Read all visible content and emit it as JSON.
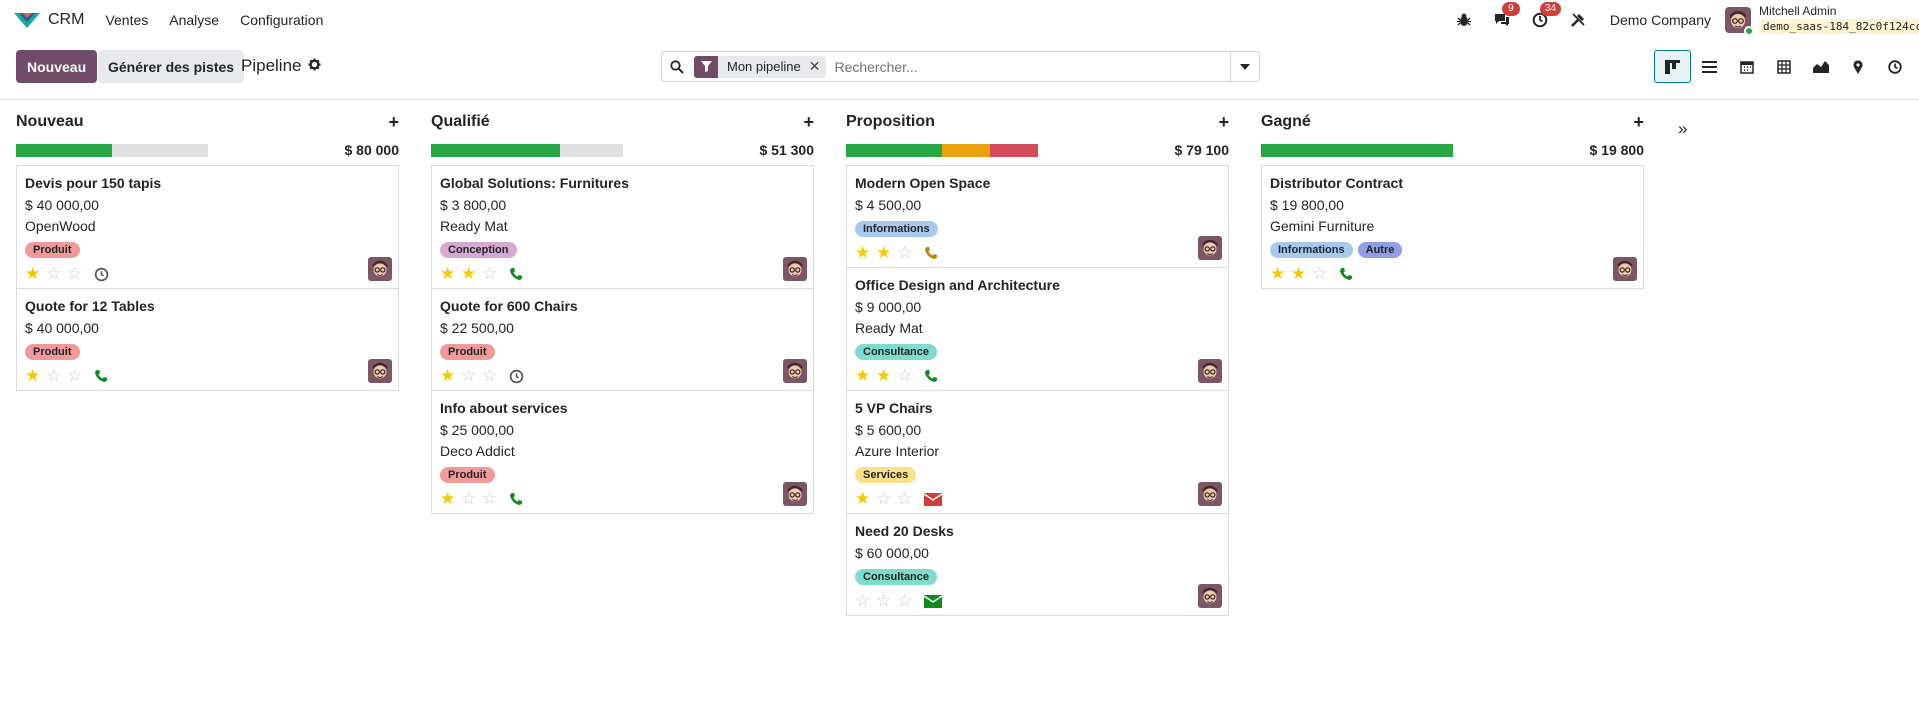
{
  "app": {
    "name": "CRM",
    "logo": "odoo-crm-icon"
  },
  "menu": [
    "Ventes",
    "Analyse",
    "Configuration"
  ],
  "systray": {
    "messages_badge": "9",
    "activities_badge": "34",
    "company": "Demo Company",
    "user_name": "Mitchell Admin",
    "db_name": "demo_saas-184_82c0f124cc..."
  },
  "control": {
    "new_label": "Nouveau",
    "generate_label": "Générer des pistes",
    "breadcrumb": "Pipeline"
  },
  "search": {
    "facet": "Mon pipeline",
    "placeholder": "Rechercher..."
  },
  "colors": {
    "primary": "#714b67",
    "green": "#28a745",
    "orange": "#e8a30c",
    "red": "#d44c59"
  },
  "columns": [
    {
      "title": "Nouveau",
      "total": "$ 80 000",
      "progress": [
        {
          "color": "#28a745",
          "pct": 50
        }
      ],
      "cards": [
        {
          "title": "Devis pour 150 tapis",
          "amount": "$ 40 000,00",
          "company": "OpenWood",
          "tags": [
            {
              "label": "Produit",
              "bg": "#f29a9a"
            }
          ],
          "stars": 1,
          "activity": "clock"
        },
        {
          "title": "Quote for 12 Tables",
          "amount": "$ 40 000,00",
          "company": "",
          "tags": [
            {
              "label": "Produit",
              "bg": "#f29a9a"
            }
          ],
          "stars": 1,
          "activity": "phone-green"
        }
      ]
    },
    {
      "title": "Qualifié",
      "total": "$ 51 300",
      "progress": [
        {
          "color": "#28a745",
          "pct": 67
        }
      ],
      "cards": [
        {
          "title": "Global Solutions: Furnitures",
          "amount": "$ 3 800,00",
          "company": "Ready Mat",
          "tags": [
            {
              "label": "Conception",
              "bg": "#d7a9d0"
            }
          ],
          "stars": 2,
          "activity": "phone-green"
        },
        {
          "title": "Quote for 600 Chairs",
          "amount": "$ 22 500,00",
          "company": "",
          "tags": [
            {
              "label": "Produit",
              "bg": "#f29a9a"
            }
          ],
          "stars": 1,
          "activity": "clock"
        },
        {
          "title": "Info about services",
          "amount": "$ 25 000,00",
          "company": "Deco Addict",
          "tags": [
            {
              "label": "Produit",
              "bg": "#f29a9a"
            }
          ],
          "stars": 1,
          "activity": "phone-green"
        }
      ]
    },
    {
      "title": "Proposition",
      "total": "$ 79 100",
      "progress": [
        {
          "color": "#28a745",
          "pct": 50
        },
        {
          "color": "#e8a30c",
          "pct": 25
        },
        {
          "color": "#d44c59",
          "pct": 25
        }
      ],
      "cards": [
        {
          "title": "Modern Open Space",
          "amount": "$ 4 500,00",
          "company": "",
          "tags": [
            {
              "label": "Informations",
              "bg": "#a8c9ef"
            }
          ],
          "stars": 2,
          "activity": "phone-orange"
        },
        {
          "title": "Office Design and Architecture",
          "amount": "$ 9 000,00",
          "company": "Ready Mat",
          "tags": [
            {
              "label": "Consultance",
              "bg": "#7fdccd"
            }
          ],
          "stars": 2,
          "activity": "phone-green"
        },
        {
          "title": "5 VP Chairs",
          "amount": "$ 5 600,00",
          "company": "Azure Interior",
          "tags": [
            {
              "label": "Services",
              "bg": "#fbe08a"
            }
          ],
          "stars": 1,
          "activity": "mail-red"
        },
        {
          "title": "Need 20 Desks",
          "amount": "$ 60 000,00",
          "company": "",
          "tags": [
            {
              "label": "Consultance",
              "bg": "#7fdccd"
            }
          ],
          "stars": 0,
          "activity": "mail-green"
        }
      ]
    },
    {
      "title": "Gagné",
      "total": "$ 19 800",
      "progress": [
        {
          "color": "#28a745",
          "pct": 100
        }
      ],
      "cards": [
        {
          "title": "Distributor Contract",
          "amount": "$ 19 800,00",
          "company": "Gemini Furniture",
          "tags": [
            {
              "label": "Informations",
              "bg": "#a8c9ef"
            },
            {
              "label": "Autre",
              "bg": "#8f9de6"
            }
          ],
          "stars": 2,
          "activity": "phone-green"
        }
      ]
    }
  ]
}
